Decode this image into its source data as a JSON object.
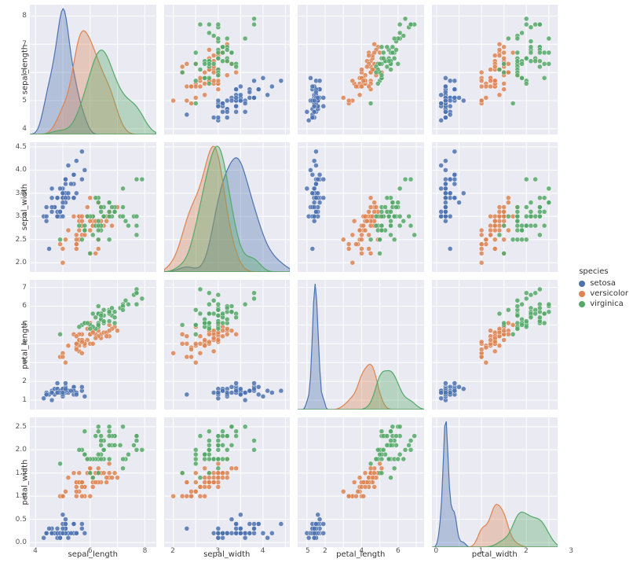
{
  "chart_data": {
    "type": "pairplot",
    "variables": [
      "sepal_length",
      "sepal_width",
      "petal_length",
      "petal_width"
    ],
    "hue": "species",
    "legend": {
      "title": "species",
      "entries": [
        "setosa",
        "versicolor",
        "virginica"
      ]
    },
    "colors": {
      "setosa": "#4c72b0",
      "versicolor": "#dd8452",
      "virginica": "#55a868"
    },
    "axis_limits": {
      "sepal_length": [
        3.8,
        8.4
      ],
      "sepal_width": [
        1.8,
        4.6
      ],
      "petal_length": [
        0.5,
        7.4
      ],
      "petal_width": [
        -0.1,
        2.7
      ]
    },
    "ticks": {
      "sepal_length": [
        4,
        5,
        6,
        7,
        8
      ],
      "sepal_width": [
        2.0,
        2.5,
        3.0,
        3.5,
        4.0,
        4.5
      ],
      "petal_length": [
        1,
        2,
        3,
        4,
        5,
        6,
        7
      ],
      "petal_width": [
        0.0,
        0.5,
        1.0,
        1.5,
        2.0,
        2.5
      ]
    },
    "x_ticks_displayed": {
      "sepal_length": [
        4,
        6,
        8
      ],
      "sepal_width": [
        2,
        3,
        4,
        5
      ],
      "petal_length": [
        2,
        4,
        6
      ],
      "petal_width": [
        0,
        1,
        2,
        3
      ]
    },
    "kde_peaks_approx": {
      "sepal_length": {
        "setosa": 5.0,
        "versicolor": 5.9,
        "virginica": 6.5
      },
      "sepal_width": {
        "setosa": 3.4,
        "versicolor": 2.8,
        "virginica": 3.0
      },
      "petal_length": {
        "setosa": 1.5,
        "versicolor": 4.3,
        "virginica": 5.5
      },
      "petal_width": {
        "setosa": 0.2,
        "versicolor": 1.3,
        "virginica": 2.0
      }
    },
    "series": [
      {
        "name": "setosa",
        "sepal_length": [
          5.1,
          4.9,
          4.7,
          4.6,
          5.0,
          5.4,
          4.6,
          5.0,
          4.4,
          4.9,
          5.4,
          4.8,
          4.8,
          4.3,
          5.8,
          5.7,
          5.4,
          5.1,
          5.7,
          5.1,
          5.4,
          5.1,
          4.6,
          5.1,
          4.8,
          5.0,
          5.0,
          5.2,
          5.2,
          4.7,
          4.8,
          5.4,
          5.2,
          5.5,
          4.9,
          5.0,
          5.5,
          4.9,
          4.4,
          5.1,
          5.0,
          4.5,
          4.4,
          5.0,
          5.1,
          4.8,
          5.1,
          4.6,
          5.3,
          5.0
        ],
        "sepal_width": [
          3.5,
          3.0,
          3.2,
          3.1,
          3.6,
          3.9,
          3.4,
          3.4,
          2.9,
          3.1,
          3.7,
          3.4,
          3.0,
          3.0,
          4.0,
          4.4,
          3.9,
          3.5,
          3.8,
          3.8,
          3.4,
          3.7,
          3.6,
          3.3,
          3.4,
          3.0,
          3.4,
          3.5,
          3.4,
          3.2,
          3.1,
          3.4,
          4.1,
          4.2,
          3.1,
          3.2,
          3.5,
          3.6,
          3.0,
          3.4,
          3.5,
          2.3,
          3.2,
          3.5,
          3.8,
          3.0,
          3.8,
          3.2,
          3.7,
          3.3
        ],
        "petal_length": [
          1.4,
          1.4,
          1.3,
          1.5,
          1.4,
          1.7,
          1.4,
          1.5,
          1.4,
          1.5,
          1.5,
          1.6,
          1.4,
          1.1,
          1.2,
          1.5,
          1.3,
          1.4,
          1.7,
          1.5,
          1.7,
          1.5,
          1.0,
          1.7,
          1.9,
          1.6,
          1.6,
          1.5,
          1.4,
          1.6,
          1.6,
          1.5,
          1.5,
          1.4,
          1.5,
          1.2,
          1.3,
          1.4,
          1.3,
          1.5,
          1.3,
          1.3,
          1.3,
          1.6,
          1.9,
          1.4,
          1.6,
          1.4,
          1.5,
          1.4
        ],
        "petal_width": [
          0.2,
          0.2,
          0.2,
          0.2,
          0.2,
          0.4,
          0.3,
          0.2,
          0.2,
          0.1,
          0.2,
          0.2,
          0.1,
          0.1,
          0.2,
          0.4,
          0.4,
          0.3,
          0.3,
          0.3,
          0.2,
          0.4,
          0.2,
          0.5,
          0.2,
          0.2,
          0.4,
          0.2,
          0.2,
          0.2,
          0.2,
          0.4,
          0.1,
          0.2,
          0.2,
          0.2,
          0.2,
          0.1,
          0.2,
          0.2,
          0.3,
          0.3,
          0.2,
          0.6,
          0.4,
          0.3,
          0.2,
          0.2,
          0.2,
          0.2
        ]
      },
      {
        "name": "versicolor",
        "sepal_length": [
          7.0,
          6.4,
          6.9,
          5.5,
          6.5,
          5.7,
          6.3,
          4.9,
          6.6,
          5.2,
          5.0,
          5.9,
          6.0,
          6.1,
          5.6,
          6.7,
          5.6,
          5.8,
          6.2,
          5.6,
          5.9,
          6.1,
          6.3,
          6.1,
          6.4,
          6.6,
          6.8,
          6.7,
          6.0,
          5.7,
          5.5,
          5.5,
          5.8,
          6.0,
          5.4,
          6.0,
          6.7,
          6.3,
          5.6,
          5.5,
          5.5,
          6.1,
          5.8,
          5.0,
          5.6,
          5.7,
          5.7,
          6.2,
          5.1,
          5.7
        ],
        "sepal_width": [
          3.2,
          3.2,
          3.1,
          2.3,
          2.8,
          2.8,
          3.3,
          2.4,
          2.9,
          2.7,
          2.0,
          3.0,
          2.2,
          2.9,
          2.9,
          3.1,
          3.0,
          2.7,
          2.2,
          2.5,
          3.2,
          2.8,
          2.5,
          2.8,
          2.9,
          3.0,
          2.8,
          3.0,
          2.9,
          2.6,
          2.4,
          2.4,
          2.7,
          2.7,
          3.0,
          3.4,
          3.1,
          2.3,
          3.0,
          2.5,
          2.6,
          3.0,
          2.6,
          2.3,
          2.7,
          3.0,
          2.9,
          2.9,
          2.5,
          2.8
        ],
        "petal_length": [
          4.7,
          4.5,
          4.9,
          4.0,
          4.6,
          4.5,
          4.7,
          3.3,
          4.6,
          3.9,
          3.5,
          4.2,
          4.0,
          4.7,
          3.6,
          4.4,
          4.5,
          4.1,
          4.5,
          3.9,
          4.8,
          4.0,
          4.9,
          4.7,
          4.3,
          4.4,
          4.8,
          5.0,
          4.5,
          3.5,
          3.8,
          3.7,
          3.9,
          5.1,
          4.5,
          4.5,
          4.7,
          4.4,
          4.1,
          4.0,
          4.4,
          4.6,
          4.0,
          3.3,
          4.2,
          4.2,
          4.2,
          4.3,
          3.0,
          4.1
        ],
        "petal_width": [
          1.4,
          1.5,
          1.5,
          1.3,
          1.5,
          1.3,
          1.6,
          1.0,
          1.3,
          1.4,
          1.0,
          1.5,
          1.0,
          1.4,
          1.3,
          1.4,
          1.5,
          1.0,
          1.5,
          1.1,
          1.8,
          1.3,
          1.5,
          1.2,
          1.3,
          1.4,
          1.4,
          1.7,
          1.5,
          1.0,
          1.1,
          1.0,
          1.2,
          1.6,
          1.5,
          1.6,
          1.5,
          1.3,
          1.3,
          1.3,
          1.2,
          1.4,
          1.2,
          1.0,
          1.3,
          1.2,
          1.3,
          1.3,
          1.1,
          1.3
        ]
      },
      {
        "name": "virginica",
        "sepal_length": [
          6.3,
          5.8,
          7.1,
          6.3,
          6.5,
          7.6,
          4.9,
          7.3,
          6.7,
          7.2,
          6.5,
          6.4,
          6.8,
          5.7,
          5.8,
          6.4,
          6.5,
          7.7,
          7.7,
          6.0,
          6.9,
          5.6,
          7.7,
          6.3,
          6.7,
          7.2,
          6.2,
          6.1,
          6.4,
          7.2,
          7.4,
          7.9,
          6.4,
          6.3,
          6.1,
          7.7,
          6.3,
          6.4,
          6.0,
          6.9,
          6.7,
          6.9,
          5.8,
          6.8,
          6.7,
          6.7,
          6.3,
          6.5,
          6.2,
          5.9
        ],
        "sepal_width": [
          3.3,
          2.7,
          3.0,
          2.9,
          3.0,
          3.0,
          2.5,
          2.9,
          2.5,
          3.6,
          3.2,
          2.7,
          3.0,
          2.5,
          2.8,
          3.2,
          3.0,
          3.8,
          2.6,
          2.2,
          3.2,
          2.8,
          2.8,
          2.7,
          3.3,
          3.2,
          2.8,
          3.0,
          2.8,
          3.0,
          2.8,
          3.8,
          2.8,
          2.8,
          2.6,
          3.0,
          3.4,
          3.1,
          3.0,
          3.1,
          3.1,
          3.1,
          2.7,
          3.2,
          3.3,
          3.0,
          2.5,
          3.0,
          3.4,
          3.0
        ],
        "petal_length": [
          6.0,
          5.1,
          5.9,
          5.6,
          5.8,
          6.6,
          4.5,
          6.3,
          5.8,
          6.1,
          5.1,
          5.3,
          5.5,
          5.0,
          5.1,
          5.3,
          5.5,
          6.7,
          6.9,
          5.0,
          5.7,
          4.9,
          6.7,
          4.9,
          5.7,
          6.0,
          4.8,
          4.9,
          5.6,
          5.8,
          6.1,
          6.4,
          5.6,
          5.1,
          5.6,
          6.1,
          5.6,
          5.5,
          4.8,
          5.4,
          5.6,
          5.1,
          5.1,
          5.9,
          5.7,
          5.2,
          5.0,
          5.2,
          5.4,
          5.1
        ],
        "petal_width": [
          2.5,
          1.9,
          2.1,
          1.8,
          2.2,
          2.1,
          1.7,
          1.8,
          1.8,
          2.5,
          2.0,
          1.9,
          2.1,
          2.0,
          2.4,
          2.3,
          1.8,
          2.2,
          2.3,
          1.5,
          2.3,
          2.0,
          2.0,
          1.8,
          2.1,
          1.8,
          1.8,
          1.8,
          2.1,
          1.6,
          1.9,
          2.0,
          2.2,
          1.5,
          1.4,
          2.3,
          2.4,
          1.8,
          1.8,
          2.1,
          2.4,
          2.3,
          1.9,
          2.3,
          2.5,
          2.3,
          1.9,
          2.0,
          2.3,
          1.8
        ]
      }
    ]
  },
  "labels": {
    "sepal_length": "sepal_length",
    "sepal_width": "sepal_width",
    "petal_length": "petal_length",
    "petal_width": "petal_width"
  },
  "legend": {
    "title": "species",
    "items": [
      "setosa",
      "versicolor",
      "virginica"
    ]
  }
}
